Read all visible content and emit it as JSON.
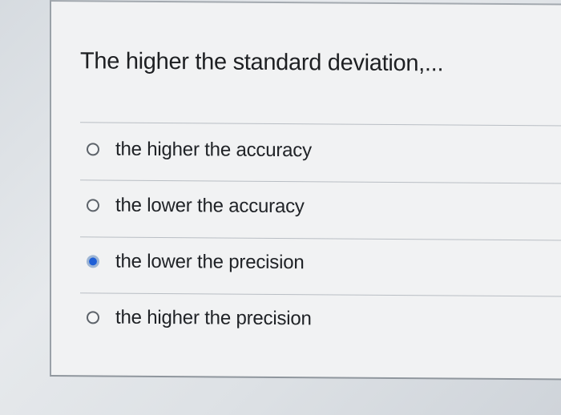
{
  "question": {
    "text": "The higher the standard deviation,..."
  },
  "options": [
    {
      "label": "the higher the accuracy",
      "selected": false,
      "icon": "radio-unchecked-icon"
    },
    {
      "label": "the lower the accuracy",
      "selected": false,
      "icon": "radio-unchecked-icon"
    },
    {
      "label": "the lower the precision",
      "selected": true,
      "icon": "radio-checked-icon"
    },
    {
      "label": "the higher the precision",
      "selected": false,
      "icon": "radio-unchecked-icon"
    }
  ],
  "colors": {
    "radio_selected": "#1f5fd6",
    "card_background": "#f1f2f3",
    "text": "#202327"
  }
}
